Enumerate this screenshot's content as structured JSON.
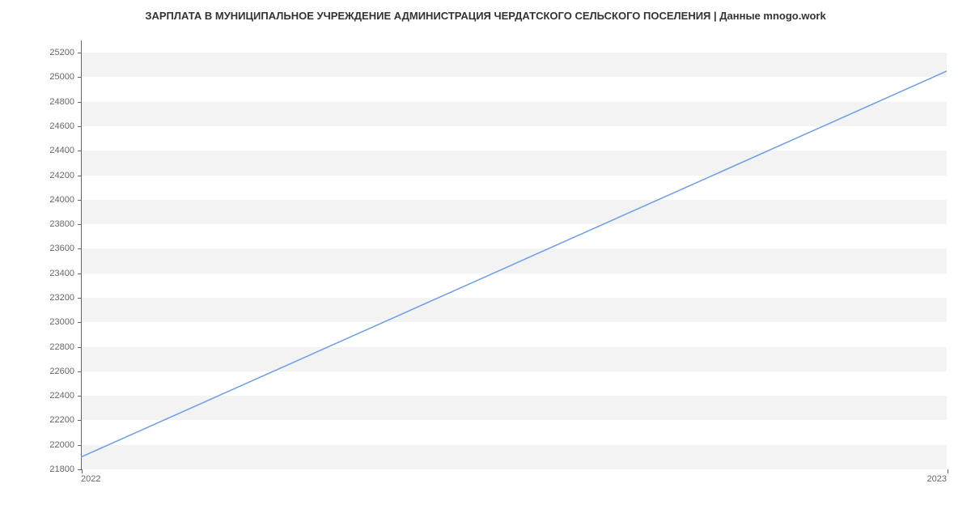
{
  "chart_data": {
    "type": "line",
    "title": "ЗАРПЛАТА В МУНИЦИПАЛЬНОЕ УЧРЕЖДЕНИЕ АДМИНИСТРАЦИЯ ЧЕРДАТСКОГО СЕЛЬСКОГО ПОСЕЛЕНИЯ | Данные mnogo.work",
    "xlabel": "",
    "ylabel": "",
    "x": [
      "2022",
      "2023"
    ],
    "values": [
      21900,
      25050
    ],
    "ylim": [
      21800,
      25300
    ],
    "y_ticks": [
      21800,
      22000,
      22200,
      22400,
      22600,
      22800,
      23000,
      23200,
      23400,
      23600,
      23800,
      24000,
      24200,
      24400,
      24600,
      24800,
      25000,
      25200
    ],
    "x_ticks": [
      "2022",
      "2023"
    ],
    "line_color": "#6b9de8",
    "grid_band_color": "#f3f3f3"
  }
}
